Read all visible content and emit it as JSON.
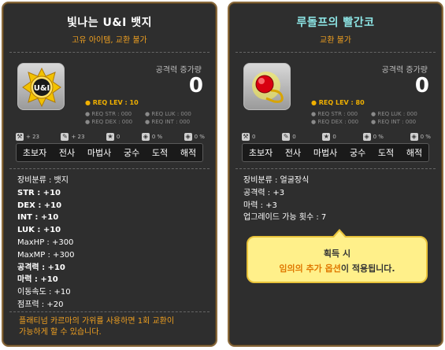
{
  "left_item": {
    "name": "빛나는 U&I 뱃지",
    "subtitle": "고유 아이템, 교환 불가",
    "icon": "uni-badge-icon",
    "attack_increase_label": "공격력 증가량",
    "attack_increase_value": "0",
    "req_lev": "● REQ LEV :   10",
    "req_str": "● REQ STR : 000",
    "req_luk": "● REQ LUK : 000",
    "req_dex": "● REQ DEX : 000",
    "req_int": "● REQ INT : 000",
    "slot1": "+ 23",
    "slot2": "+ 23",
    "slot3": "0",
    "slot4": "0 %",
    "slot5": "0 %",
    "jobs": [
      "초보자",
      "전사",
      "마법사",
      "궁수",
      "도적",
      "해적"
    ],
    "stats": [
      "장비분류 : 뱃지",
      "STR : +10",
      "DEX : +10",
      "INT : +10",
      "LUK : +10",
      "MaxHP : +300",
      "MaxMP : +300",
      "공격력 : +10",
      "마력 : +10",
      "이동속도 : +10",
      "점프력 : +20"
    ],
    "notice_line1": "플래티넘 카르마의 가위를 사용하면 1회 교환이",
    "notice_line2": "가능하게 할 수 있습니다."
  },
  "right_item": {
    "name": "루돌프의 빨간코",
    "subtitle": "교환 불가",
    "icon": "red-nose-icon",
    "attack_increase_label": "공격력 증가량",
    "attack_increase_value": "0",
    "req_lev": "● REQ LEV :   80",
    "req_str": "● REQ STR : 000",
    "req_luk": "● REQ LUK : 000",
    "req_dex": "● REQ DEX : 000",
    "req_int": "● REQ INT : 000",
    "slot1": "0",
    "slot2": "0",
    "slot3": "0",
    "slot4": "0 %",
    "slot5": "0 %",
    "jobs": [
      "초보자",
      "전사",
      "마법사",
      "궁수",
      "도적",
      "해적"
    ],
    "stats": [
      "장비분류 : 얼굴장식",
      "공격력 : +3",
      "마력 : +3",
      "업그레이드 가능 횟수 : 7"
    ],
    "tooltip_line1": "획득 시",
    "tooltip_highlight": "임의의 추가 옵션",
    "tooltip_rest": "이 적용됩니다."
  },
  "colors": {
    "panel_bg": "#2e2e2e",
    "border": "#8a6a3c",
    "orange": "#f0a020",
    "cyan_title": "#8ee6e6",
    "tooltip_bg": "#fff08a"
  }
}
